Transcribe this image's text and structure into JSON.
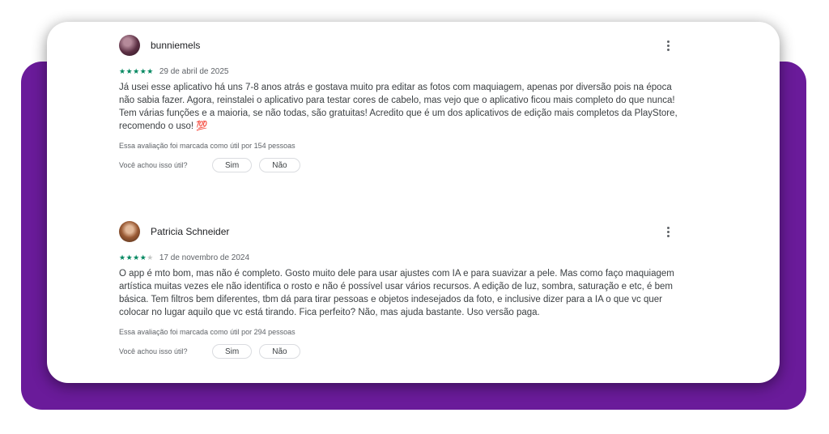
{
  "reviews": [
    {
      "username": "bunniemels",
      "rating": 5,
      "stars_text": "★★★★★",
      "stars_empty": "",
      "date": "29 de abril de 2025",
      "text": "Já usei esse aplicativo há uns 7-8 anos atrás e gostava muito pra editar as fotos com maquiagem, apenas por diversão pois na época não sabia fazer. Agora, reinstalei o aplicativo para testar cores de cabelo, mas vejo que o aplicativo ficou mais completo do que nunca! Tem várias funções e a maioria, se não todas, são gratuitas! Acredito que é um dos aplicativos de edição mais completos da PlayStore, recomendo o uso! 💯",
      "helpful_count": "Essa avaliação foi marcada como útil por 154 pessoas",
      "helpful_question": "Você achou isso útil?",
      "yes_label": "Sim",
      "no_label": "Não"
    },
    {
      "username": "Patricia Schneider",
      "rating": 4,
      "stars_text": "★★★★",
      "stars_empty": "★",
      "date": "17 de novembro de 2024",
      "text": "O app é mto bom, mas não é completo. Gosto muito dele para usar ajustes com IA e para suavizar a pele. Mas como faço maquiagem artística muitas vezes ele não identifica o rosto e não é possível usar vários recursos. A edição de luz, sombra, saturação e etc, é bem básica. Tem filtros bem diferentes, tbm dá para tirar pessoas e objetos indesejados da foto, e inclusive dizer para a IA o que vc quer colocar no lugar aquilo que vc está tirando. Fica perfeito? Não, mas ajuda bastante. Uso versão paga.",
      "helpful_count": "Essa avaliação foi marcada como útil por 294 pessoas",
      "helpful_question": "Você achou isso útil?",
      "yes_label": "Sim",
      "no_label": "Não"
    }
  ],
  "colors": {
    "accent_purple": "#6a1b9a",
    "star_green": "#01875f"
  },
  "icons": {
    "more": "more-vert-icon"
  }
}
